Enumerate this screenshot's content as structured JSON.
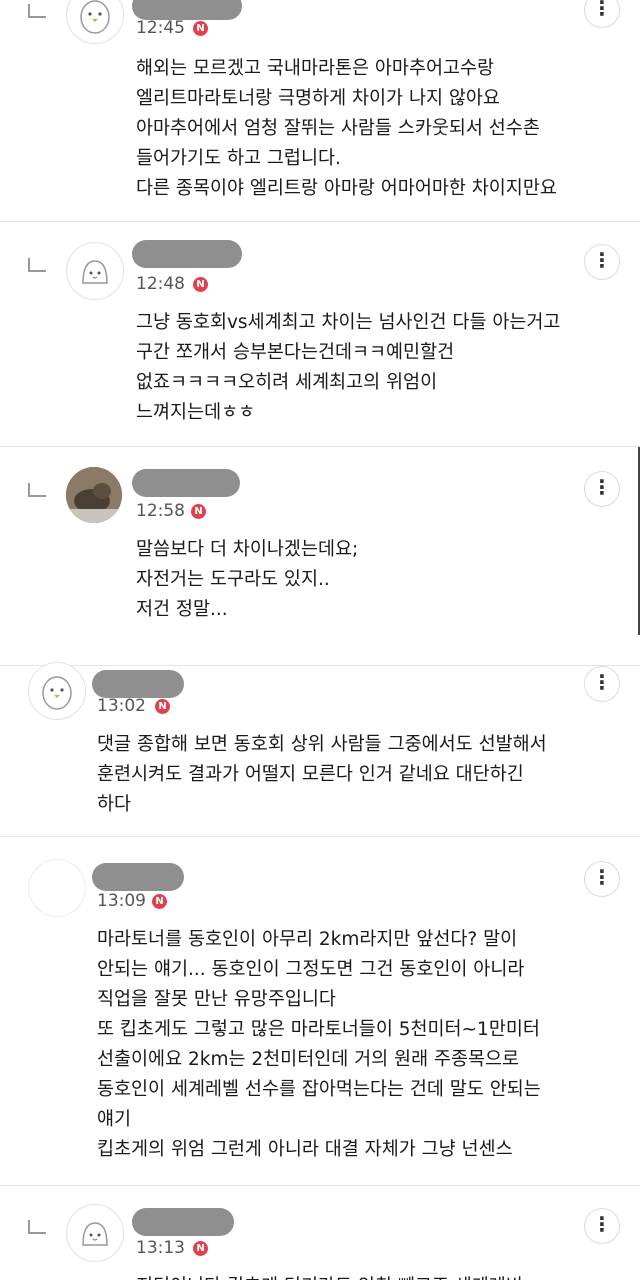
{
  "badge_letter": "N",
  "more_symbol": "⋮",
  "comments": [
    {
      "time": "12:45",
      "avatar": "penguin-avatar-icon",
      "lines": [
        "해외는 모르겠고 국내마라톤은 아마추어고수랑",
        "엘리트마라토너랑 극명하게 차이가 나지 않아요",
        "아마추어에서 엄청 잘뛰는 사람들 스카웃되서 선수촌",
        "들어가기도 하고 그럽니다.",
        "다른 종목이야 엘리트랑 아마랑 어마어마한 차이지만요"
      ]
    },
    {
      "time": "12:48",
      "avatar": "blob-avatar-icon",
      "lines": [
        "그냥 동호회vs세계최고 차이는 넘사인건 다들 아는거고",
        "구간 쪼개서 승부본다는건데ㅋㅋ예민할건",
        "없죠ㅋㅋㅋㅋ오히려 세계최고의 위엄이",
        "느껴지는데ㅎㅎ"
      ]
    },
    {
      "time": "12:58",
      "avatar": "cat-photo-avatar",
      "lines": [
        "말씀보다 더 차이나겠는데요;",
        "자전거는 도구라도 있지..",
        "저건 정말..."
      ]
    },
    {
      "time": "13:02",
      "avatar": "penguin-avatar-icon",
      "lines": [
        "댓글 종합해 보면 동호회 상위 사람들 그중에서도 선발해서",
        "훈련시켜도 결과가 어떨지 모른다 인거 같네요 대단하긴",
        "하다"
      ]
    },
    {
      "time": "13:09",
      "avatar": "empty-avatar",
      "lines": [
        "마라토너를 동호인이 아무리 2km라지만 앞선다? 말이",
        "안되는 얘기... 동호인이 그정도면 그건 동호인이 아니라",
        "직업을 잘못 만난 유망주입니다",
        "또 킵초게도 그렇고 많은 마라토너들이 5천미터~1만미터",
        "선출이에요 2km는 2천미터인데 거의 원래 주종목으로",
        "동호인이 세계레벨 선수를 잡아먹는다는 건데 말도 안되는",
        "얘기",
        "킵초게의 위엄 그런게 아니라 대결 자체가 그냥 넌센스"
      ]
    },
    {
      "time": "13:13",
      "avatar": "blob-avatar-icon",
      "lines": [
        "지던이니다 킵초게 던기라도 인취 빼고죠 세계레비"
      ]
    }
  ]
}
